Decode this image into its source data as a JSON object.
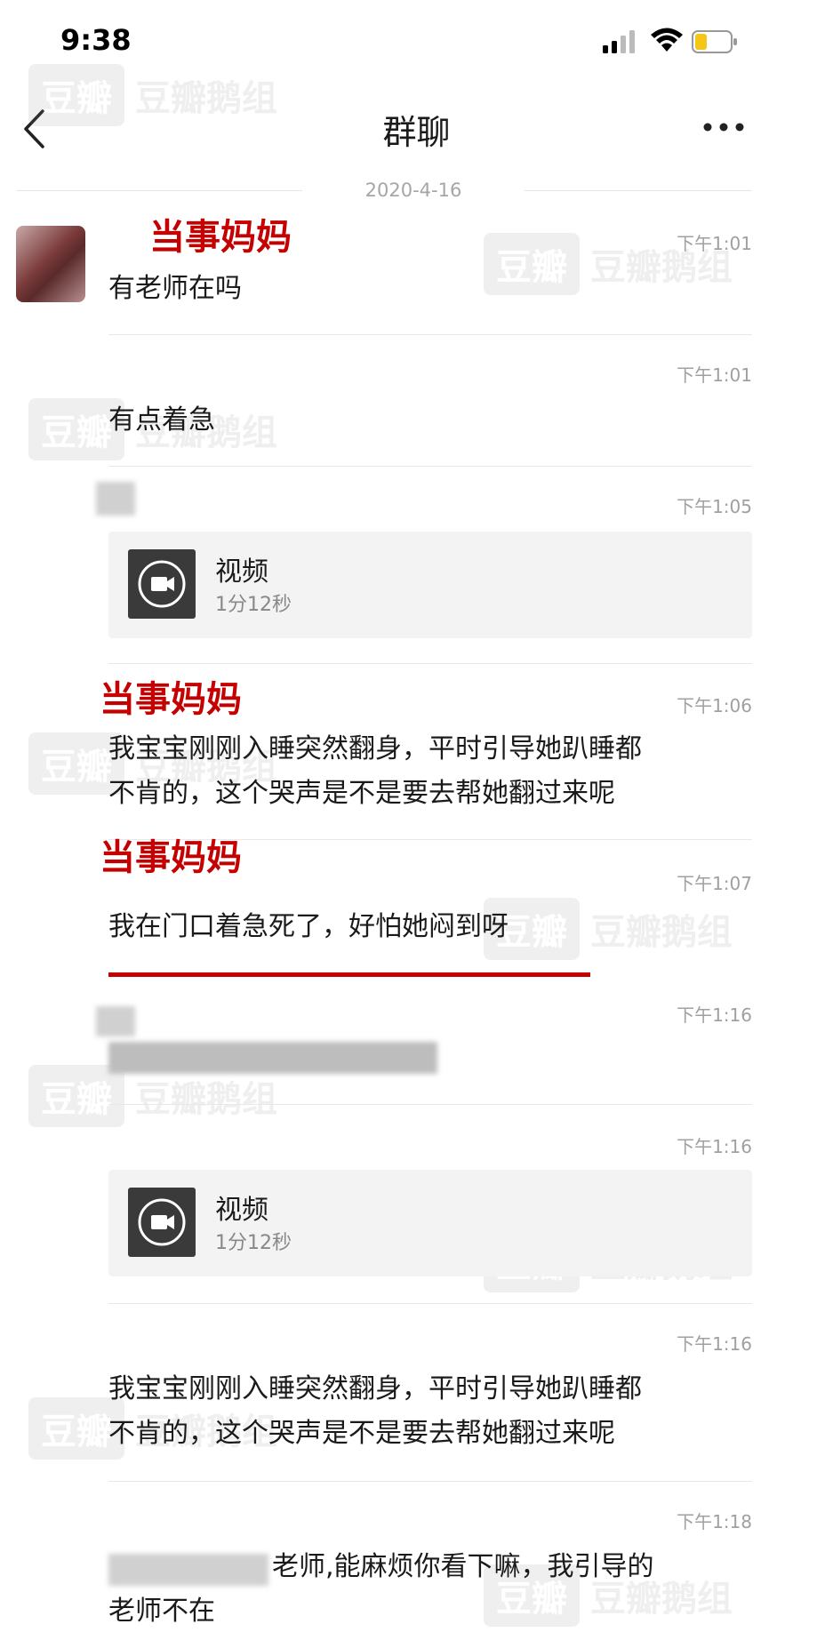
{
  "status_bar": {
    "time": "9:38"
  },
  "nav": {
    "title": "群聊",
    "back_icon": "chevron-left-icon",
    "more_icon": "more-dots-icon"
  },
  "date_divider": "2020-4-16",
  "annotations": {
    "label": "当事妈妈",
    "color": "#c40000"
  },
  "watermark": {
    "box": "豆瓣",
    "text": "豆瓣鹅组"
  },
  "messages": [
    {
      "time": "下午1:01",
      "text": "有老师在吗"
    },
    {
      "time": "下午1:01",
      "text": "有点着急"
    },
    {
      "time": "下午1:05",
      "video": {
        "title": "视频",
        "duration": "1分12秒"
      }
    },
    {
      "time": "下午1:06",
      "line1": "我宝宝刚刚入睡突然翻身，平时引导她趴睡都",
      "line2": "不肯的，这个哭声是不是要去帮她翻过来呢"
    },
    {
      "time": "下午1:07",
      "text": "我在门口着急死了，好怕她闷到呀"
    },
    {
      "time": "下午1:16"
    },
    {
      "time": "下午1:16",
      "video": {
        "title": "视频",
        "duration": "1分12秒"
      }
    },
    {
      "time": "下午1:16",
      "line1": "我宝宝刚刚入睡突然翻身，平时引导她趴睡都",
      "line2": "不肯的，这个哭声是不是要去帮她翻过来呢"
    },
    {
      "time": "下午1:18",
      "line1": "老师,能麻烦你看下嘛，我引导的",
      "line2": "老师不在"
    }
  ]
}
